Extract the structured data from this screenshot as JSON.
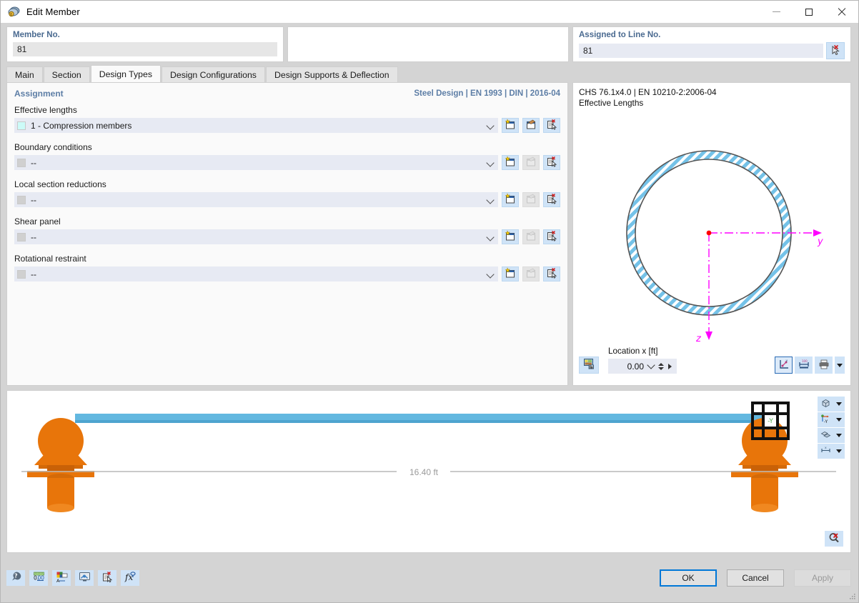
{
  "window": {
    "title": "Edit Member",
    "icon": "member-icon",
    "minimize_label": "Minimize",
    "maximize_label": "Maximize",
    "close_label": "Close"
  },
  "header": {
    "member_no_label": "Member No.",
    "member_no_value": "81",
    "assigned_line_label": "Assigned to Line No.",
    "assigned_line_value": "81",
    "pick_icon": "select-line-icon"
  },
  "tabs": [
    {
      "label": "Main",
      "active": false
    },
    {
      "label": "Section",
      "active": false
    },
    {
      "label": "Design Types",
      "active": true
    },
    {
      "label": "Design Configurations",
      "active": false
    },
    {
      "label": "Design Supports & Deflection",
      "active": false
    }
  ],
  "assignment": {
    "title": "Assignment",
    "standard": "Steel Design | EN 1993 | DIN | 2016-04",
    "rows": [
      {
        "label": "Effective lengths",
        "value": "1 - Compression members",
        "swatch": "#ccfbf8",
        "new_enabled": true,
        "edit_enabled": true,
        "pick_enabled": true
      },
      {
        "label": "Boundary conditions",
        "value": "--",
        "swatch": "#d0d0d0",
        "new_enabled": true,
        "edit_enabled": false,
        "pick_enabled": true
      },
      {
        "label": "Local section reductions",
        "value": "--",
        "swatch": "#d0d0d0",
        "new_enabled": true,
        "edit_enabled": false,
        "pick_enabled": true
      },
      {
        "label": "Shear panel",
        "value": "--",
        "swatch": "#d0d0d0",
        "new_enabled": true,
        "edit_enabled": false,
        "pick_enabled": true
      },
      {
        "label": "Rotational restraint",
        "value": "--",
        "swatch": "#d0d0d0",
        "new_enabled": true,
        "edit_enabled": false,
        "pick_enabled": true
      }
    ],
    "row_buttons": {
      "new_icon": "new-document-icon",
      "edit_icon": "edit-document-icon",
      "pick_icon": "pick-from-model-icon"
    }
  },
  "preview": {
    "section_name": "CHS 76.1x4.0 | EN 10210-2:2006-04",
    "subtitle": "Effective Lengths",
    "axis_y_label": "y",
    "axis_z_label": "z",
    "location_label": "Location x [ft]",
    "location_value": "0.00",
    "render_icon": "render-section-icon",
    "buttons": [
      {
        "icon": "coordinate-system-icon",
        "selected": true
      },
      {
        "icon": "dimensions-icon",
        "selected": false
      },
      {
        "icon": "print-icon",
        "selected": false
      }
    ],
    "colors": {
      "section_fill": "#74c2e8",
      "axis": "#ff00ff"
    }
  },
  "viewport": {
    "dimension_label": "16.40 ft",
    "member_color": "#63b8e0",
    "support_color": "#e8750a",
    "viewcube_label": "-Y",
    "toolbar": [
      {
        "icon": "render-mode-icon",
        "has_dropdown": true
      },
      {
        "icon": "view-direction-icon",
        "has_dropdown": true,
        "label": "-Y"
      },
      {
        "icon": "display-layers-icon",
        "has_dropdown": true
      },
      {
        "icon": "dimension-display-icon",
        "has_dropdown": true
      }
    ],
    "zoom_reset_icon": "zoom-reset-icon"
  },
  "bottom_toolbar": [
    {
      "icon": "help-info-icon"
    },
    {
      "icon": "units-decimal-icon"
    },
    {
      "icon": "display-properties-icon"
    },
    {
      "icon": "visualization-icon"
    },
    {
      "icon": "pick-object-icon"
    },
    {
      "icon": "formula-icon"
    }
  ],
  "dialog_buttons": {
    "ok": "OK",
    "cancel": "Cancel",
    "apply": "Apply"
  }
}
